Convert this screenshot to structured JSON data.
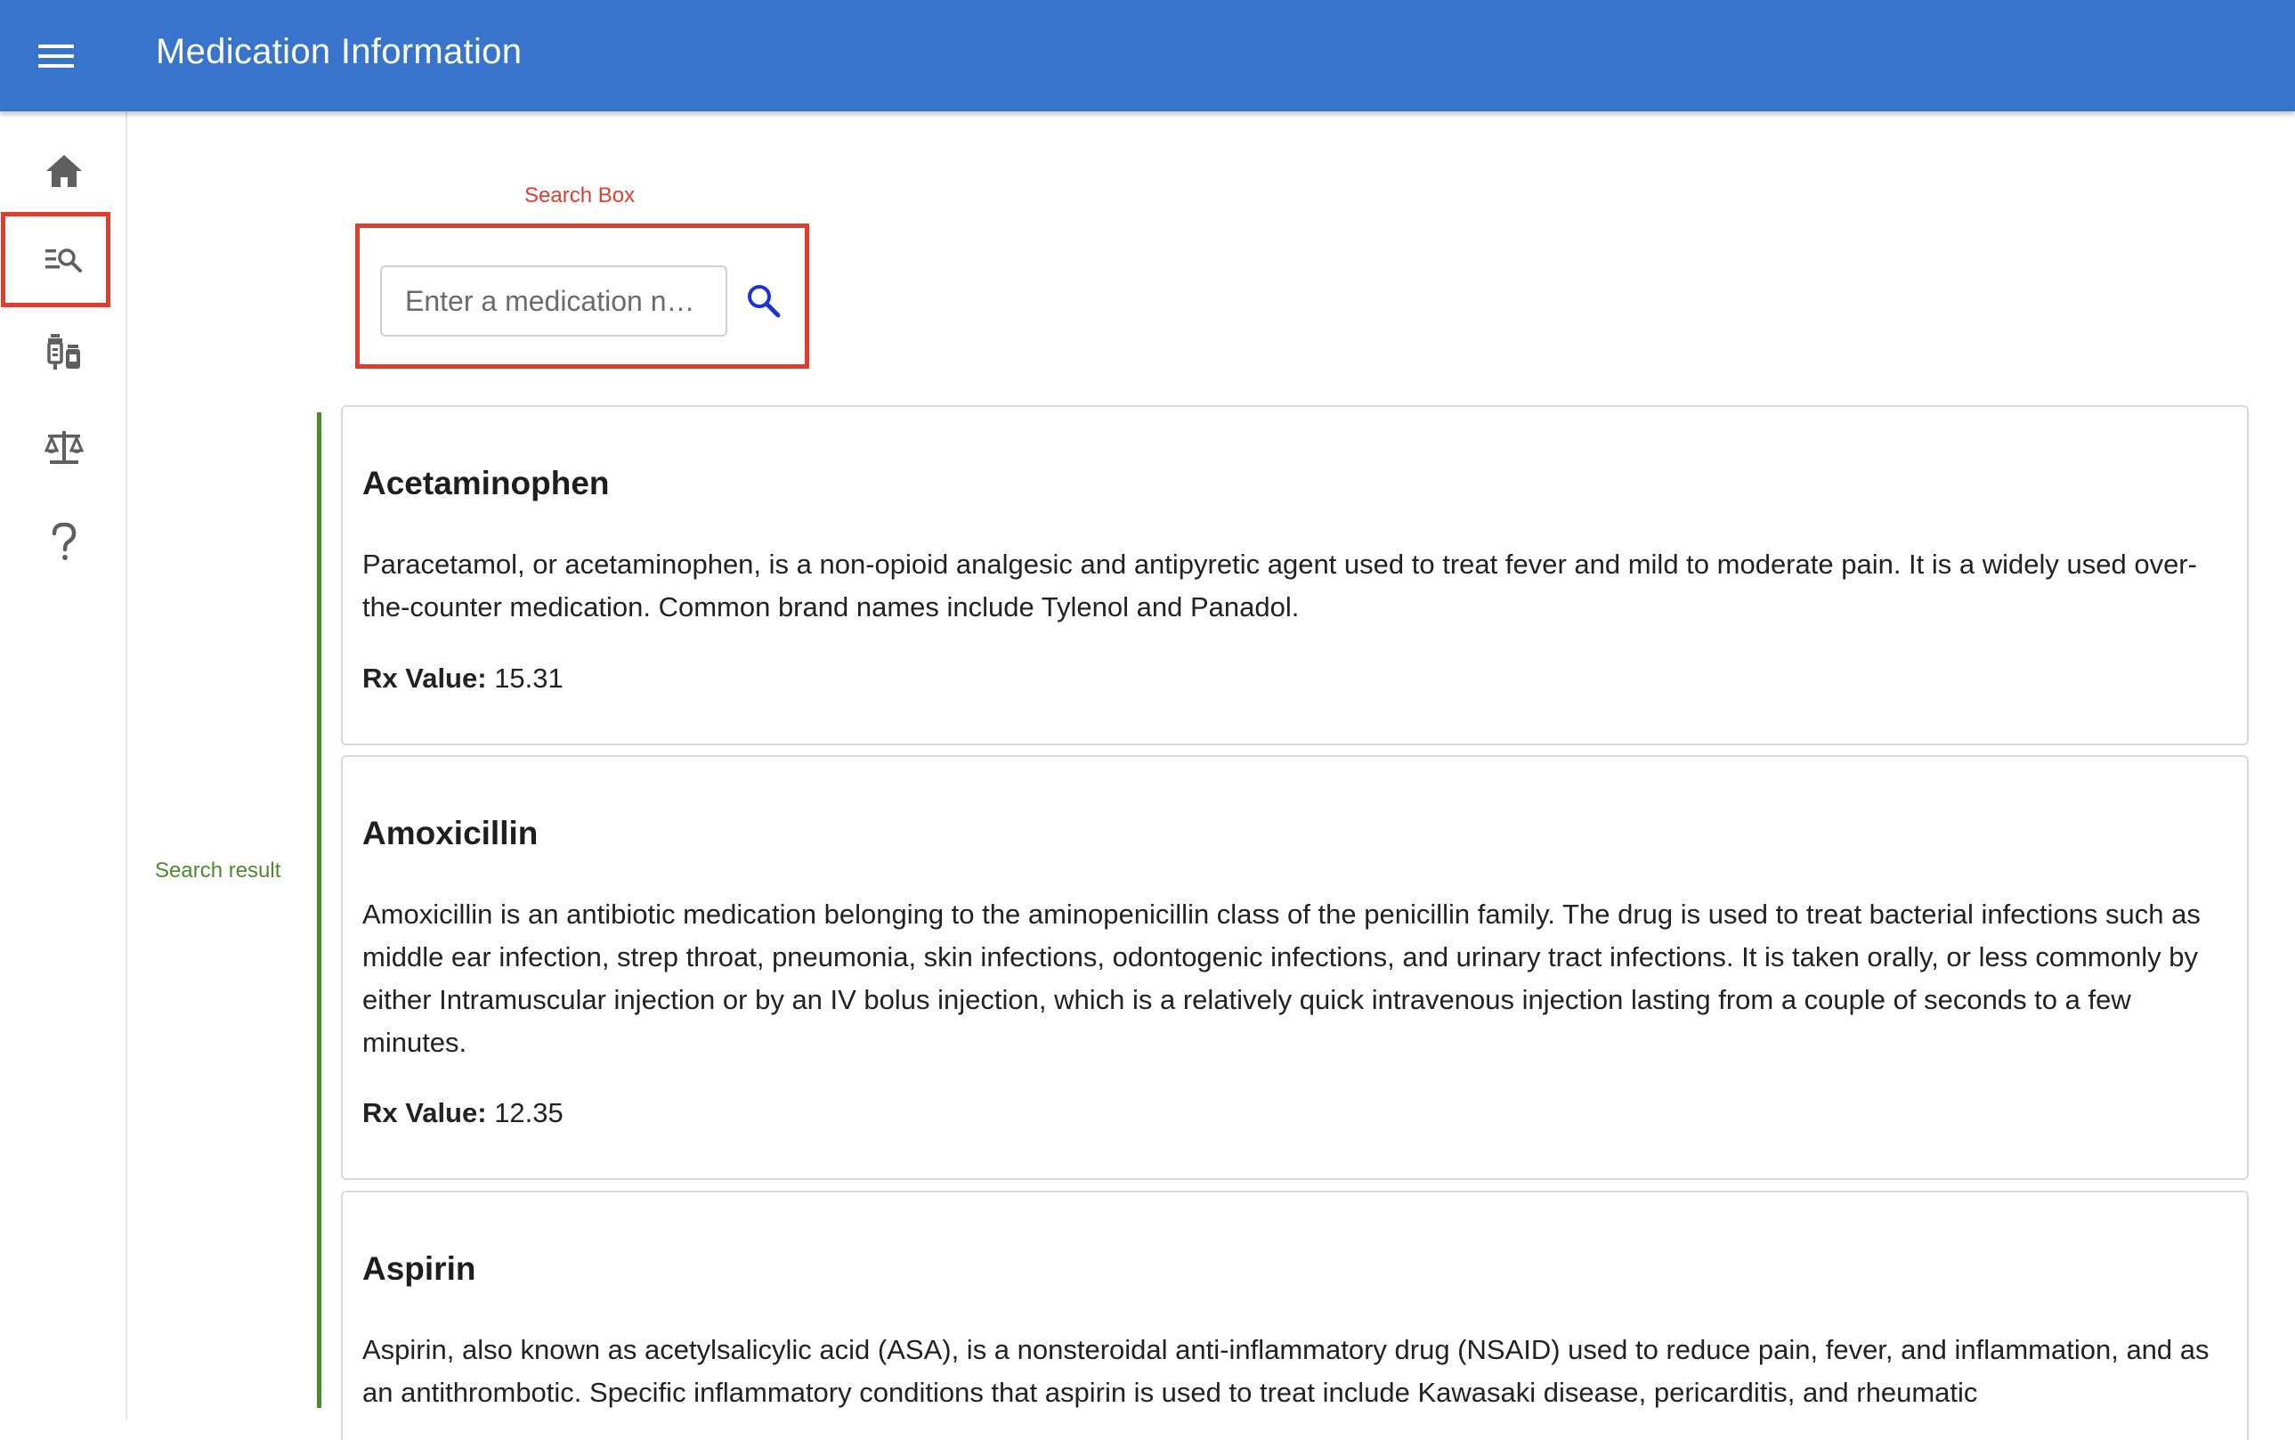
{
  "header": {
    "title": "Medication Information"
  },
  "sidebar": {
    "items": [
      {
        "name": "home",
        "icon": "home-icon"
      },
      {
        "name": "search",
        "icon": "manage-search-icon",
        "active": true
      },
      {
        "name": "medication",
        "icon": "medication-icon"
      },
      {
        "name": "compare",
        "icon": "balance-scale-icon"
      },
      {
        "name": "help",
        "icon": "help-question-icon"
      }
    ]
  },
  "annotations": {
    "search_box": "Search Box",
    "search_result": "Search result",
    "search_box_color": "#e23c2c",
    "search_result_color": "#4d8a2d"
  },
  "search": {
    "placeholder": "Enter a medication n…",
    "value": "",
    "button_icon": "search-icon"
  },
  "results": [
    {
      "name": "Acetaminophen",
      "description": "Paracetamol, or acetaminophen, is a non-opioid analgesic and antipyretic agent used to treat fever and mild to moderate pain. It is a widely used over-the-counter medication. Common brand names include Tylenol and Panadol.",
      "rx_label": "Rx Value:",
      "rx_value": "15.31"
    },
    {
      "name": "Amoxicillin",
      "description": "Amoxicillin is an antibiotic medication belonging to the aminopenicillin class of the penicillin family. The drug is used to treat bacterial infections such as middle ear infection, strep throat, pneumonia, skin infections, odontogenic infections, and urinary tract infections. It is taken orally, or less commonly by either Intramuscular injection or by an IV bolus injection, which is a relatively quick intravenous injection lasting from a couple of seconds to a few minutes.",
      "rx_label": "Rx Value:",
      "rx_value": "12.35"
    },
    {
      "name": "Aspirin",
      "description": "Aspirin, also known as acetylsalicylic acid (ASA), is a nonsteroidal anti-inflammatory drug (NSAID) used to reduce pain, fever, and inflammation, and as an antithrombotic. Specific inflammatory conditions that aspirin is used to treat include Kawasaki disease, pericarditis, and rheumatic"
    }
  ],
  "colors": {
    "app_bar": "#3874cc",
    "accent_search": "#1a33d6"
  }
}
